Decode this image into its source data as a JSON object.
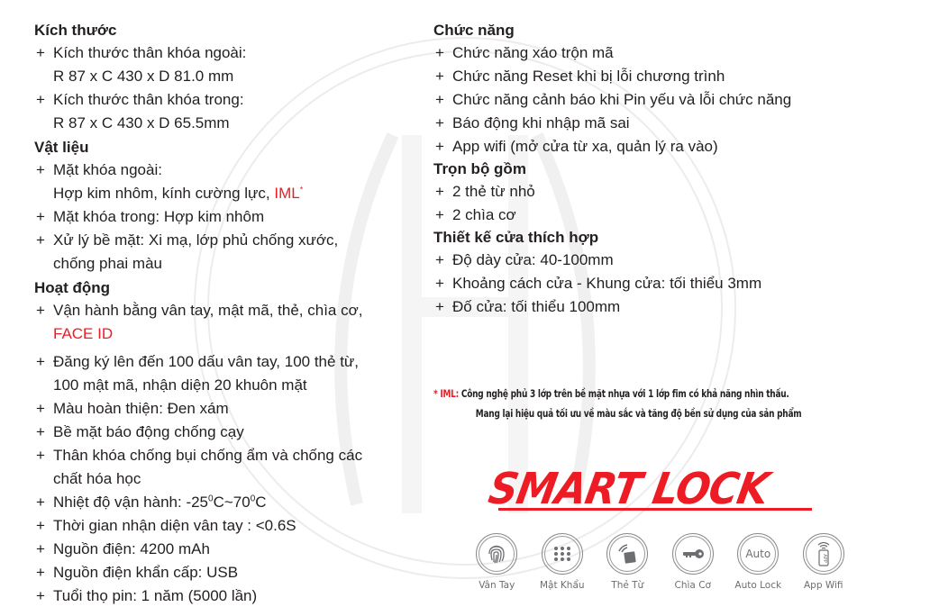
{
  "left_column": {
    "sections": [
      {
        "title": "Kích thước",
        "items": [
          {
            "text": "Kích thước thân khóa ngoài:",
            "cont": "R 87 x C 430 x D 81.0 mm"
          },
          {
            "text": "Kích thước thân khóa trong:",
            "cont": "R 87 x C 430 x D 65.5mm"
          }
        ]
      },
      {
        "title": "Vật liệu",
        "items": [
          {
            "text": "Mặt khóa ngoài:",
            "cont": "Hợp kim nhôm, kính cường lực, ",
            "cont_red": "IML",
            "cont_sup": "*"
          },
          {
            "text": "Mặt khóa trong: Hợp kim nhôm"
          },
          {
            "text": "Xử lý bề mặt: Xi mạ, lớp phủ chống xước,",
            "cont": "chống phai màu"
          }
        ]
      },
      {
        "title": "Hoạt động",
        "items": [
          {
            "text": "Vận hành bằng vân tay, mật mã, thẻ, chìa cơ,",
            "cont_red": "FACE ID"
          },
          {
            "text": "Đăng ký lên đến 100 dấu vân tay, 100 thẻ từ,",
            "cont": "100 mật mã, nhận diện 20 khuôn mặt"
          },
          {
            "text": "Màu hoàn thiện: Đen xám"
          },
          {
            "text": "Bề mặt báo động chống cạy"
          },
          {
            "text": "Thân khóa chống bụi chống ẩm và chống các",
            "cont": "chất hóa học"
          },
          {
            "text_pre": "Nhiệt độ vận hành: -25",
            "deg1": "0",
            "text_mid": "C~70",
            "deg2": "0",
            "text_post": "C"
          },
          {
            "text": "Thời gian nhận diện vân tay : <0.6S"
          },
          {
            "text": "Nguồn điện: 4200 mAh"
          },
          {
            "text": "Nguồn điện khẩn cấp: USB"
          },
          {
            "text": "Tuổi thọ pin: 1 năm (5000 lần)"
          }
        ]
      }
    ]
  },
  "right_column": {
    "sections": [
      {
        "title": "Chức năng",
        "items": [
          {
            "text": "Chức năng xáo trộn mã"
          },
          {
            "text": "Chức năng Reset khi bị lỗi chương trình"
          },
          {
            "text": "Chức năng cảnh báo khi Pin yếu và lỗi chức năng"
          },
          {
            "text": "Báo động khi nhập mã sai"
          },
          {
            "text": "App wifi (mở cửa từ xa, quản lý ra vào)"
          }
        ]
      },
      {
        "title": "Trọn bộ gồm",
        "items": [
          {
            "text": "2 thẻ từ nhỏ"
          },
          {
            "text": "2 chìa cơ"
          }
        ]
      },
      {
        "title": "Thiết kế cửa thích hợp",
        "items": [
          {
            "text": "Độ dày cửa: 40-100mm"
          },
          {
            "text": "Khoảng cách cửa - Khung cửa: tối thiểu 3mm"
          },
          {
            "text": "Đố cửa: tối thiểu 100mm"
          }
        ]
      }
    ]
  },
  "bullet": "+",
  "note": {
    "label": "* IML:",
    "line1": "Công nghệ phủ 3 lớp trên bề mặt nhựa với 1 lớp fim có khả năng nhìn thấu.",
    "line2": "Mang lại hiệu quả tối ưu về màu sắc và tăng độ bền sử dụng của sản phẩm"
  },
  "brand": {
    "text": "SMART LOCK",
    "color": "#ed1c24"
  },
  "features": [
    {
      "icon": "fingerprint-icon",
      "label": "Vân Tay"
    },
    {
      "icon": "keypad-icon",
      "label": "Mật Khẩu"
    },
    {
      "icon": "card-icon",
      "label": "Thẻ Từ"
    },
    {
      "icon": "key-icon",
      "label": "Chìa Cơ"
    },
    {
      "icon": "auto-lock-icon",
      "label": "Auto Lock",
      "icon_text": "Auto"
    },
    {
      "icon": "app-wifi-icon",
      "label": "App Wifi",
      "icon_text": "APP"
    }
  ],
  "colors": {
    "text": "#231f20",
    "accent_red": "#ed1c24",
    "icon_gray": "#6d6e71"
  }
}
